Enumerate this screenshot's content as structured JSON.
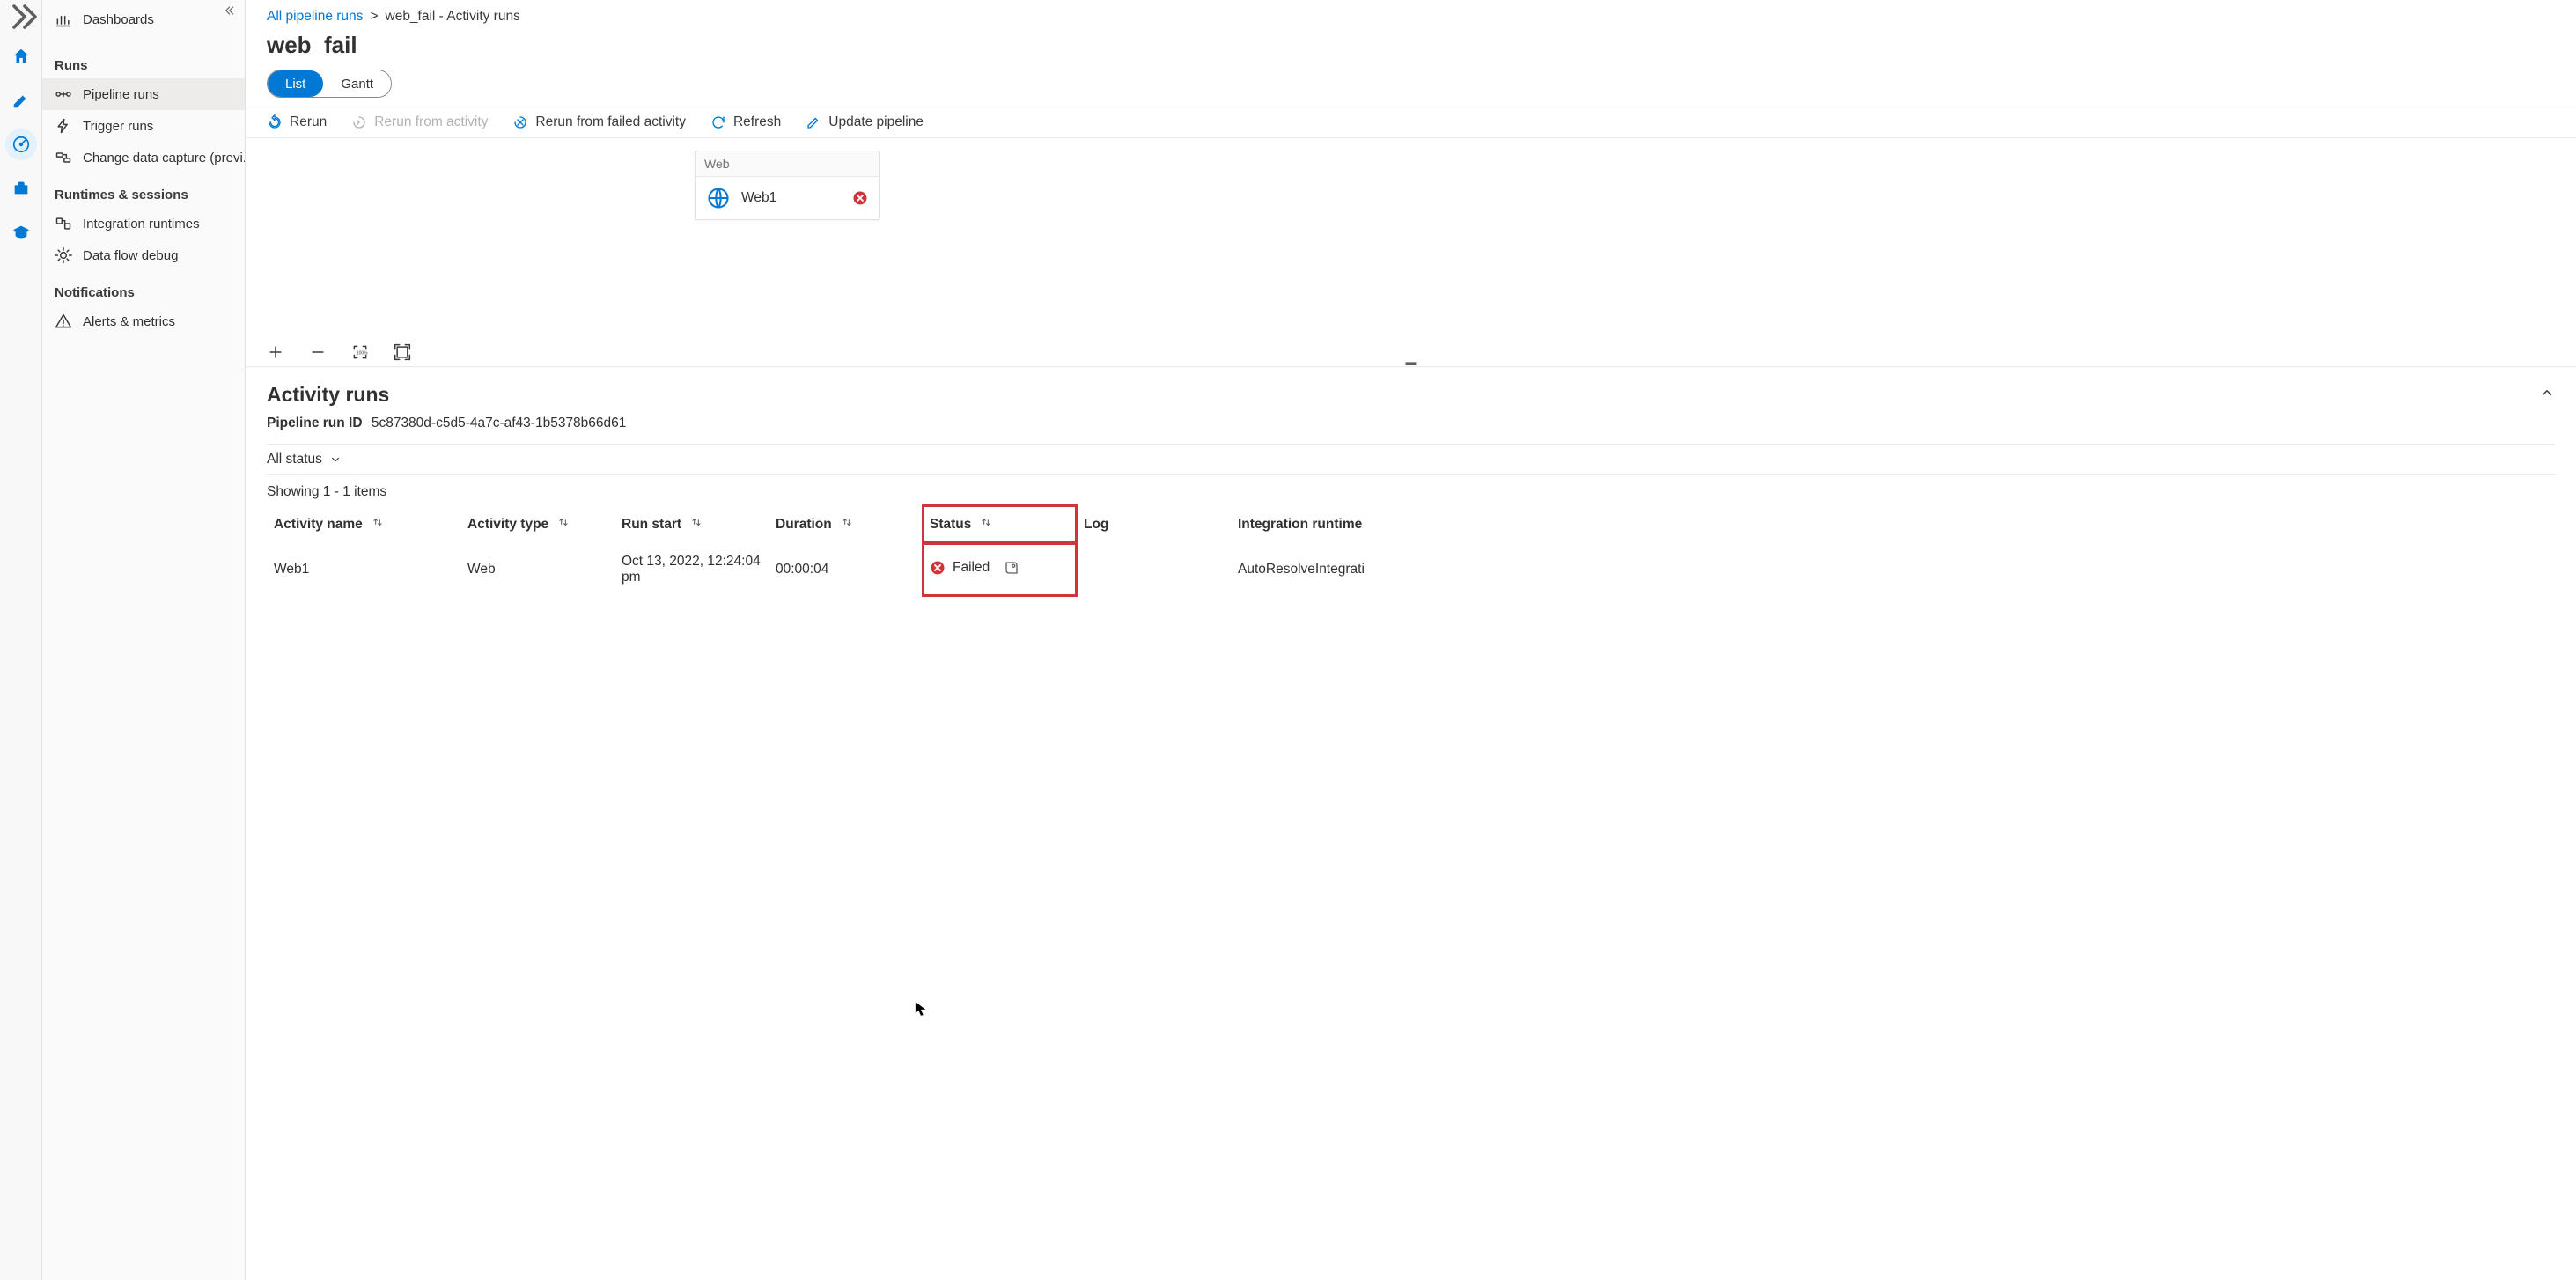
{
  "rail": {
    "expand_title": "Expand"
  },
  "sidebar": {
    "collapse_title": "Collapse",
    "dashboards": "Dashboards",
    "heading_runs": "Runs",
    "pipeline_runs": "Pipeline runs",
    "trigger_runs": "Trigger runs",
    "cdc": "Change data capture (previ...",
    "heading_runtimes": "Runtimes & sessions",
    "integration_runtimes": "Integration runtimes",
    "data_flow_debug": "Data flow debug",
    "heading_notifications": "Notifications",
    "alerts_metrics": "Alerts & metrics"
  },
  "breadcrumb": {
    "root": "All pipeline runs",
    "sep": ">",
    "current": "web_fail - Activity runs"
  },
  "page_title": "web_fail",
  "tabs": {
    "list": "List",
    "gantt": "Gantt"
  },
  "toolbar": {
    "rerun": "Rerun",
    "rerun_from_activity": "Rerun from activity",
    "rerun_from_failed": "Rerun from failed activity",
    "refresh": "Refresh",
    "update_pipeline": "Update pipeline"
  },
  "canvas": {
    "node_type": "Web",
    "node_name": "Web1"
  },
  "lower": {
    "title": "Activity runs",
    "run_id_label": "Pipeline run ID",
    "run_id": "5c87380d-c5d5-4a7c-af43-1b5378b66d61",
    "status_filter": "All status",
    "showing": "Showing 1 - 1 items",
    "columns": {
      "activity_name": "Activity name",
      "activity_type": "Activity type",
      "run_start": "Run start",
      "duration": "Duration",
      "status": "Status",
      "log": "Log",
      "integration_runtime": "Integration runtime"
    },
    "rows": [
      {
        "name": "Web1",
        "type": "Web",
        "start": "Oct 13, 2022, 12:24:04 pm",
        "duration": "00:00:04",
        "status": "Failed",
        "ir": "AutoResolveIntegrati"
      }
    ]
  }
}
